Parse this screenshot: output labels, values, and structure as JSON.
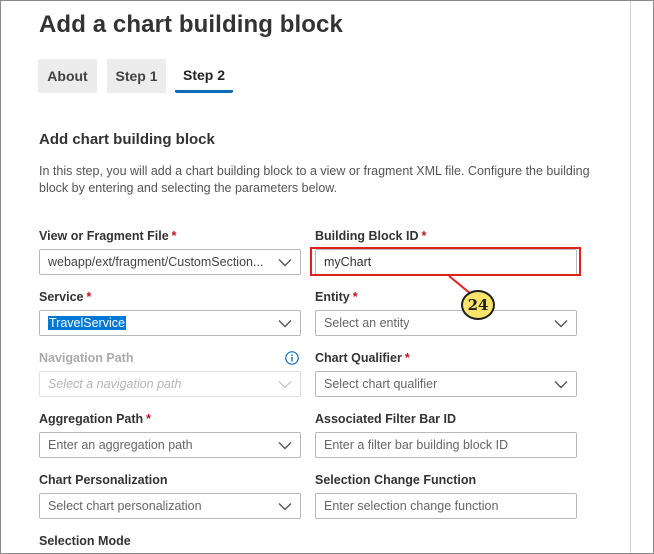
{
  "title": "Add a chart building block",
  "tabs": [
    {
      "label": "About",
      "active": false
    },
    {
      "label": "Step 1",
      "active": false
    },
    {
      "label": "Step 2",
      "active": true
    }
  ],
  "section": {
    "title": "Add chart building block",
    "intro": "In this step, you will add a chart building block to a view or fragment XML file. Configure the building block by entering and selecting the parameters below."
  },
  "required_marker": "*",
  "fields": {
    "view_file": {
      "label": "View or Fragment File",
      "value": "webapp/ext/fragment/CustomSection...",
      "required": true
    },
    "building_block_id": {
      "label": "Building Block ID",
      "value": "myChart",
      "required": true
    },
    "service": {
      "label": "Service",
      "value": "TravelService",
      "required": true
    },
    "entity": {
      "label": "Entity",
      "placeholder": "Select an entity",
      "required": true
    },
    "navigation_path": {
      "label": "Navigation Path",
      "placeholder": "Select a navigation path",
      "disabled": true
    },
    "chart_qualifier": {
      "label": "Chart Qualifier",
      "placeholder": "Select chart qualifier",
      "required": true
    },
    "aggregation_path": {
      "label": "Aggregation Path",
      "placeholder": "Enter an aggregation path",
      "required": true
    },
    "filter_bar_id": {
      "label": "Associated Filter Bar ID",
      "placeholder": "Enter a filter bar building block ID"
    },
    "personalization": {
      "label": "Chart Personalization",
      "placeholder": "Select chart personalization"
    },
    "selection_change": {
      "label": "Selection Change Function",
      "placeholder": "Enter selection change function"
    },
    "selection_mode": {
      "label": "Selection Mode"
    }
  },
  "callout": {
    "number": "24"
  },
  "colors": {
    "accent": "#0f6cbd",
    "required": "#c50f1f",
    "highlight": "#e0201c",
    "callout_fill": "#f8e46a",
    "selection": "#0078d4"
  },
  "icons": [
    "chevron-down-icon",
    "info-icon"
  ]
}
